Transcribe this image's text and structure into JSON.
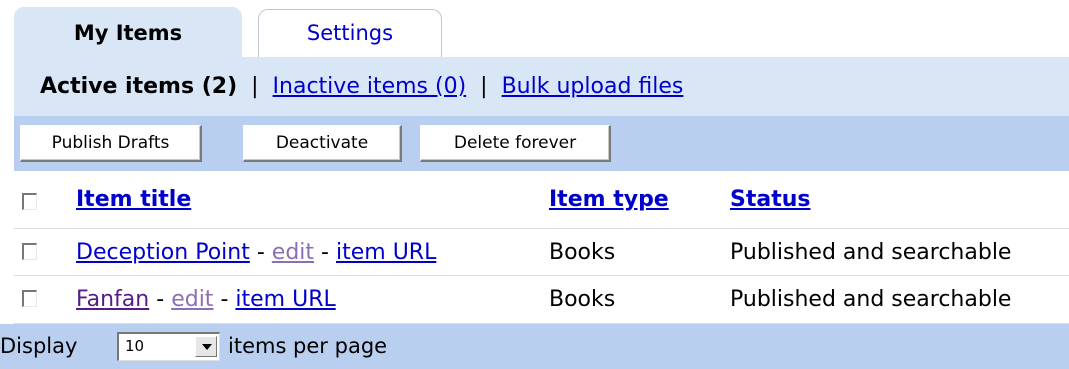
{
  "tabs": {
    "active": "My Items",
    "inactive": "Settings"
  },
  "filters": {
    "active_label": "Active items (2)",
    "separator": "|",
    "inactive_link": "Inactive items (0)",
    "bulk_link": "Bulk upload files"
  },
  "toolbar": {
    "publish": "Publish Drafts",
    "deactivate": "Deactivate",
    "delete": "Delete forever"
  },
  "table": {
    "headers": {
      "title": "Item title",
      "type": "Item type",
      "status": "Status"
    },
    "rows": [
      {
        "title": "Deception Point",
        "dash": "-",
        "edit": "edit",
        "url": "item URL",
        "type": "Books",
        "status": "Published and searchable"
      },
      {
        "title": "Fanfan",
        "dash": "-",
        "edit": "edit",
        "url": "item URL",
        "type": "Books",
        "status": "Published and searchable"
      }
    ]
  },
  "pagination": {
    "display_label": "Display",
    "per_page_value": "10",
    "per_page_label": "items per page"
  },
  "colors": {
    "tab_active_bg": "#d8e6f6",
    "toolbar_bg": "#b9cff0",
    "link": "#0000cc"
  }
}
